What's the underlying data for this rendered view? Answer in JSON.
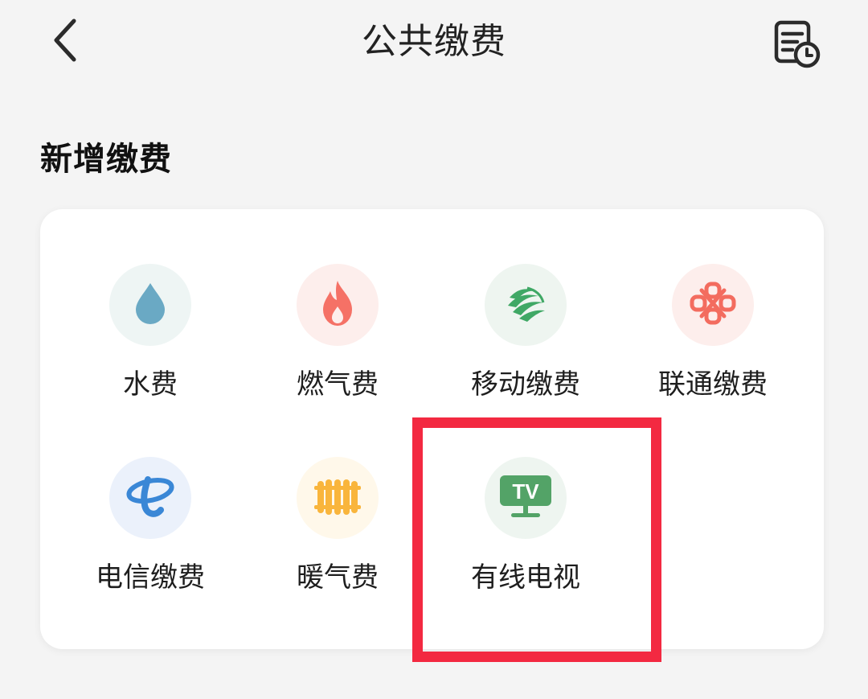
{
  "header": {
    "title": "公共缴费",
    "back_icon": "chevron-left-icon",
    "history_icon": "bill-history-icon"
  },
  "section": {
    "title": "新增缴费"
  },
  "items": [
    {
      "label": "水费",
      "icon": "water-drop-icon",
      "bg": "#eef5f4",
      "color": "#6aa9c4"
    },
    {
      "label": "燃气费",
      "icon": "flame-icon",
      "bg": "#fdeeec",
      "color": "#f57166"
    },
    {
      "label": "移动缴费",
      "icon": "china-mobile-icon",
      "bg": "#eef5f0",
      "color": "#3fa865"
    },
    {
      "label": "联通缴费",
      "icon": "china-unicom-knot-icon",
      "bg": "#fdeeec",
      "color": "#f36c5f"
    },
    {
      "label": "电信缴费",
      "icon": "china-telecom-icon",
      "bg": "#ebf1fb",
      "color": "#3a87d6"
    },
    {
      "label": "暖气费",
      "icon": "radiator-icon",
      "bg": "#fff8ea",
      "color": "#f9b53c"
    },
    {
      "label": "有线电视",
      "icon": "tv-icon",
      "bg": "#eef5f0",
      "color": "#53a367"
    }
  ],
  "highlight": {
    "color": "#f32941"
  }
}
